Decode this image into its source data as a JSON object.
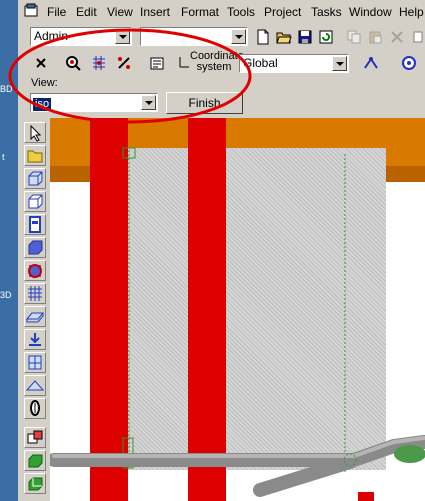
{
  "menubar": {
    "items": [
      "File",
      "Edit",
      "View",
      "Insert",
      "Format",
      "Tools",
      "Project",
      "Tasks",
      "Window",
      "Help"
    ]
  },
  "toolbar": {
    "user_combo": "Admin",
    "second_combo": "",
    "coordinate_label": "Coordinate system",
    "coordinate_combo": "Global"
  },
  "view_panel": {
    "label": "View:",
    "view_combo": "iso",
    "finish_label": "Finish"
  },
  "annotation": {
    "color": "#e00000"
  },
  "scene": {
    "background": "#ffffff",
    "member_color": "#dd0000",
    "band_color": "#d97a00"
  },
  "left_edge": {
    "fragments": [
      "BD",
      "t",
      "3D"
    ]
  }
}
